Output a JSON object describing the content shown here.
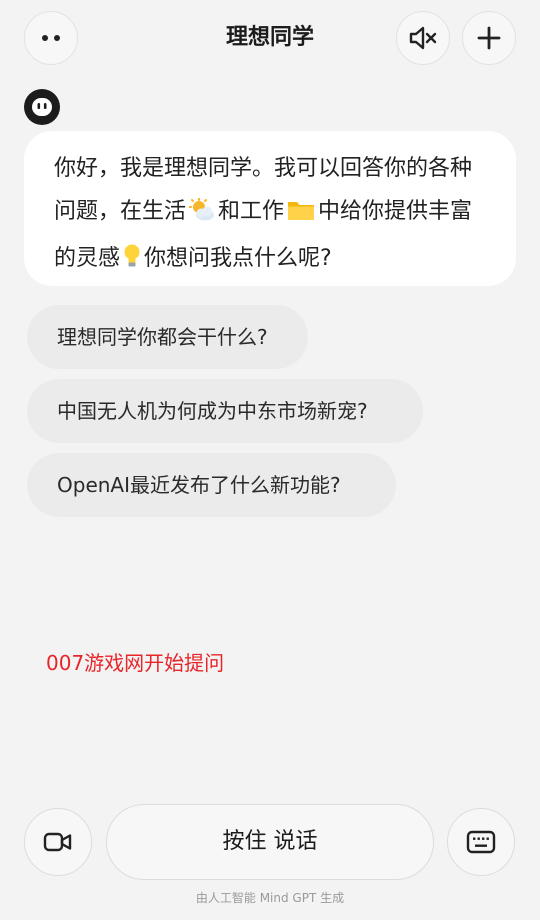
{
  "header": {
    "title": "理想同学",
    "menu_icon": "more-dots-icon",
    "mute_icon": "speaker-muted-icon",
    "new_icon": "plus-icon"
  },
  "assistant": {
    "avatar_icon": "robot-face-icon",
    "greeting_part1": "你好，我是理想同学。我可以回答你的各种问题，在生活",
    "greeting_part2": "和工作",
    "greeting_part3": "中给你提供丰富的灵感",
    "greeting_part4": "你想问我点什么呢?",
    "emojis": [
      "sun-behind-cloud-icon",
      "folder-icon",
      "light-bulb-icon"
    ]
  },
  "suggestions": [
    {
      "label": "理想同学你都会干什么?"
    },
    {
      "label": "中国无人机为何成为中东市场新宠?"
    },
    {
      "label": "OpenAI最近发布了什么新功能?"
    }
  ],
  "watermark_text": "007游戏网开始提问",
  "bottom_bar": {
    "video_icon": "video-camera-icon",
    "talk_label": "按住 说话",
    "keyboard_icon": "keyboard-icon"
  },
  "footer_text": "由人工智能 Mind GPT 生成",
  "colors": {
    "background": "#f3f3f3",
    "bubble": "#ffffff",
    "chip": "#ebebeb",
    "accent_red": "#e8262a",
    "avatar": "#1c1c1c"
  }
}
